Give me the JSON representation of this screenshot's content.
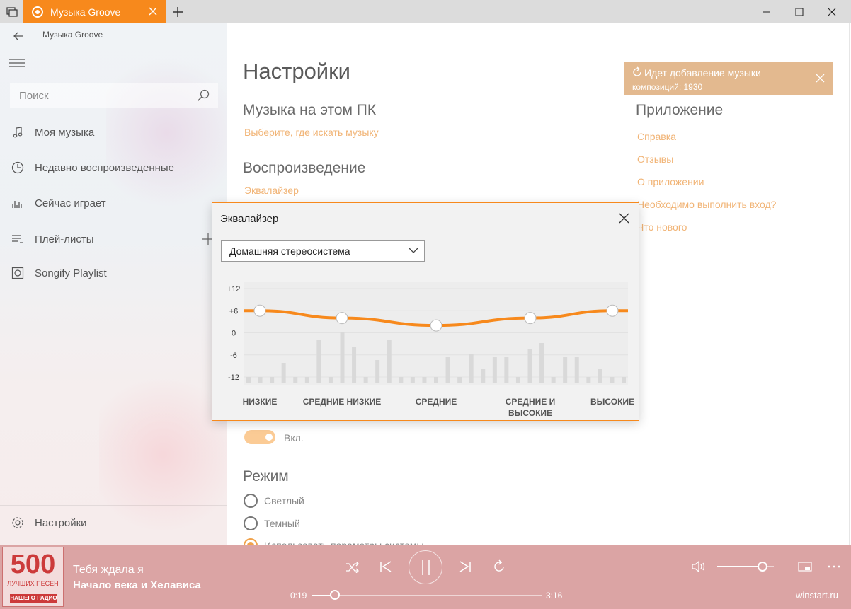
{
  "window": {
    "tab_title": "Музыка Groove"
  },
  "sidebar": {
    "app_name": "Музыка Groove",
    "search_placeholder": "Поиск",
    "items": [
      {
        "label": "Моя музыка",
        "icon": "music-note-icon"
      },
      {
        "label": "Недавно воспроизведенные",
        "icon": "clock-icon"
      },
      {
        "label": "Сейчас играет",
        "icon": "equalizer-bars-icon"
      },
      {
        "label": "Плей-листы",
        "icon": "playlist-icon"
      },
      {
        "label": "Songify Playlist",
        "icon": "playlist-disc-icon"
      }
    ],
    "settings_label": "Настройки"
  },
  "main": {
    "title": "Настройки",
    "music_section": {
      "heading": "Музыка на этом ПК",
      "link": "Выберите, где искать музыку"
    },
    "playback_section": {
      "heading": "Воспроизведение",
      "link": "Эквалайзер"
    },
    "toggle_text": "Вкл.",
    "mode_section": {
      "heading": "Режим",
      "options": [
        "Светлый",
        "Темный",
        "Использовать параметры системы"
      ]
    },
    "app_section": {
      "heading": "Приложение",
      "links": [
        "Справка",
        "Отзывы",
        "О приложении",
        "Необходимо выполнить вход?",
        "Что нового"
      ]
    }
  },
  "notification": {
    "title": "Идет добавление музыки",
    "subtitle": "композиций: 1930"
  },
  "equalizer_dialog": {
    "title": "Эквалайзер",
    "preset": "Домашняя стереосистема",
    "y_ticks": [
      "+12",
      "+6",
      "0",
      "-6",
      "-12"
    ],
    "bands": [
      {
        "label": "НИЗКИЕ",
        "value": 6
      },
      {
        "label": "СРЕДНИЕ НИЗКИЕ",
        "value": 4
      },
      {
        "label": "СРЕДНИЕ",
        "value": 2
      },
      {
        "label": "СРЕДНИЕ И ВЫСОКИЕ",
        "value": 4
      },
      {
        "label": "ВЫСОКИЕ",
        "value": 6
      }
    ],
    "accent_color": "#f7891c"
  },
  "player": {
    "cover": {
      "number": "500",
      "line1": "ЛУЧШИХ ПЕСЕН",
      "badge": "НАШЕГО РАДИО"
    },
    "song_title": "Тебя ждала я",
    "artist": "Начало века и Хелависа",
    "elapsed": "0:19",
    "duration": "3:16",
    "progress_fraction": 0.1,
    "volume_fraction": 0.8,
    "background_color": "#dba4a4"
  },
  "watermark": "winstart.ru"
}
